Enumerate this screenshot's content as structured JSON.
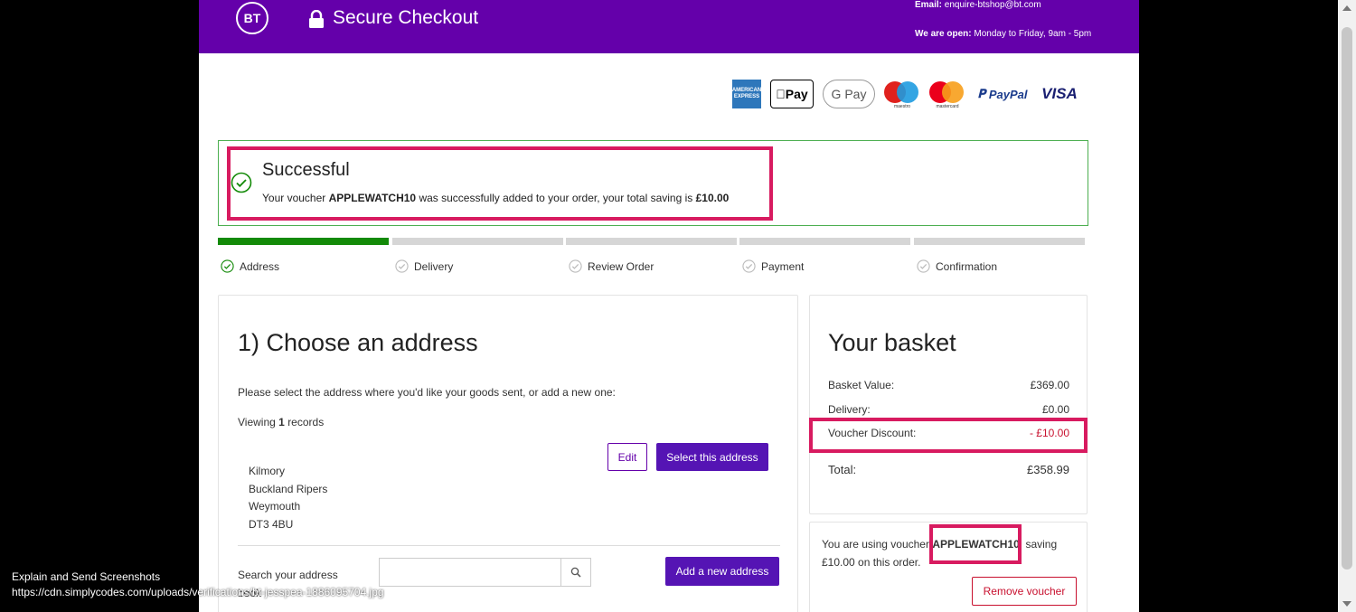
{
  "header": {
    "logo": "BT",
    "title": "Secure Checkout",
    "email_label": "Email:",
    "email_value": "enquire-btshop@bt.com",
    "open_label": "We are open:",
    "open_value": "Monday to Friday, 9am - 5pm"
  },
  "payment_methods": {
    "amex": "AMERICAN EXPRESS",
    "apple": "Pay",
    "gpay": "G Pay",
    "maestro_caption": "maestro",
    "mastercard_caption": "mastercard",
    "paypal": "PayPal",
    "visa": "VISA"
  },
  "success": {
    "title": "Successful",
    "msg_prefix": "Your voucher",
    "voucher_code": "APPLEWATCH10",
    "msg_middle": "was successfully added to your order, your total saving is",
    "amount": "£10.00"
  },
  "steps": [
    {
      "label": "Address",
      "state": "done"
    },
    {
      "label": "Delivery",
      "state": "pending"
    },
    {
      "label": "Review Order",
      "state": "pending"
    },
    {
      "label": "Payment",
      "state": "pending"
    },
    {
      "label": "Confirmation",
      "state": "pending"
    }
  ],
  "address": {
    "title": "1) Choose an address",
    "instruction": "Please select the address where you'd like your goods sent, or add a new one:",
    "viewing_prefix": "Viewing",
    "viewing_count": "1",
    "viewing_suffix": "records",
    "lines": [
      "Kilmory",
      "Buckland Ripers",
      "Weymouth",
      "DT3 4BU"
    ],
    "edit_label": "Edit",
    "select_label": "Select this address",
    "search_label": "Search your address book",
    "search_value": "",
    "add_label": "Add a new address"
  },
  "basket": {
    "title": "Your basket",
    "rows": [
      {
        "label": "Basket Value:",
        "value": "£369.00"
      },
      {
        "label": "Delivery:",
        "value": "£0.00"
      },
      {
        "label": "Voucher Discount:",
        "value": "- £10.00"
      },
      {
        "label": "Total:",
        "value": "£358.99"
      }
    ]
  },
  "voucher": {
    "prefix": "You are using voucher",
    "code": "APPLEWATCH10",
    "suffix": ", saving £10.00 on this order.",
    "remove_label": "Remove voucher"
  },
  "overlay": {
    "line1": "Explain and Send Screenshots",
    "line2": "https://cdn.simplycodes.com/uploads/verifications/bt-jesspea-1886095704.jpg"
  },
  "colors": {
    "brand_purple": "#6400aa",
    "button_purple": "#5514b4",
    "success_green": "#138a08",
    "highlight_pink": "#d81b60",
    "discount_red": "#c8102e"
  }
}
